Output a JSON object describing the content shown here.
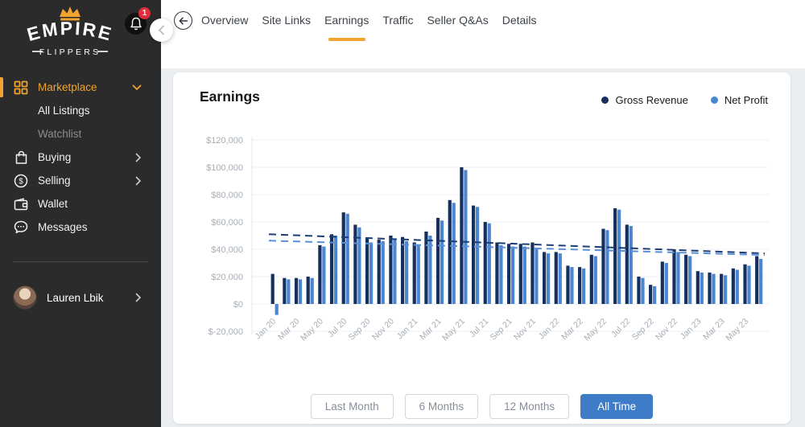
{
  "colors": {
    "accent_orange": "#f0a32f",
    "button_blue": "#3e7cc7",
    "sidebar_bg": "#2b2b2b",
    "gross_navy": "#16305e",
    "net_blue": "#4b86d2"
  },
  "sidebar": {
    "logo": {
      "title": "EMPIRE",
      "subtitle": "FLIPPERS"
    },
    "notification_count": "1",
    "items": [
      {
        "label": "Marketplace",
        "icon": "grid-icon",
        "active": true,
        "chevron": "down"
      },
      {
        "label": "All Listings"
      },
      {
        "label": "Watchlist",
        "muted": true
      },
      {
        "label": "Buying",
        "icon": "bag-icon",
        "chevron": "right"
      },
      {
        "label": "Selling",
        "icon": "dollar-icon",
        "chevron": "right"
      },
      {
        "label": "Wallet",
        "icon": "wallet-icon"
      },
      {
        "label": "Messages",
        "icon": "chat-icon"
      }
    ],
    "user": {
      "name": "Lauren Lbik"
    }
  },
  "topnav": {
    "tabs": [
      {
        "label": "Overview",
        "active": false
      },
      {
        "label": "Site Links",
        "active": false
      },
      {
        "label": "Earnings",
        "active": true
      },
      {
        "label": "Traffic",
        "active": false
      },
      {
        "label": "Seller Q&As",
        "active": false
      },
      {
        "label": "Details",
        "active": false
      }
    ]
  },
  "main": {
    "card_title": "Earnings",
    "legend": [
      {
        "label": "Gross Revenue",
        "color": "#16305e"
      },
      {
        "label": "Net Profit",
        "color": "#4b86d2"
      }
    ],
    "range_buttons": [
      {
        "label": "Last Month",
        "active": false
      },
      {
        "label": "6 Months",
        "active": false
      },
      {
        "label": "12 Months",
        "active": false
      },
      {
        "label": "All Time",
        "active": true
      }
    ]
  },
  "chart_data": {
    "type": "bar",
    "title": "Earnings",
    "categories": [
      "Jan 20",
      "Feb 20",
      "Mar 20",
      "Apr 20",
      "May 20",
      "Jun 20",
      "Jul 20",
      "Aug 20",
      "Sep 20",
      "Oct 20",
      "Nov 20",
      "Dec 20",
      "Jan 21",
      "Feb 21",
      "Mar 21",
      "Apr 21",
      "May 21",
      "Jun 21",
      "Jul 21",
      "Aug 21",
      "Sep 21",
      "Oct 21",
      "Nov 21",
      "Dec 21",
      "Jan 22",
      "Feb 22",
      "Mar 22",
      "Apr 22",
      "May 22",
      "Jun 22",
      "Jul 22",
      "Aug 22",
      "Sep 22",
      "Oct 22",
      "Nov 22",
      "Dec 22",
      "Jan 23",
      "Feb 23",
      "Mar 23",
      "Apr 23",
      "May 23",
      "Jun 23"
    ],
    "x_tick_labels": [
      "Jan 20",
      "Mar 20",
      "May 20",
      "Jul 20",
      "Sep 20",
      "Nov 20",
      "Jan 21",
      "Mar 21",
      "May 21",
      "Jul 21",
      "Sep 21",
      "Nov 21",
      "Jan 22",
      "Mar 22",
      "May 22",
      "Jul 22",
      "Sep 22",
      "Nov 22",
      "Jan 23",
      "Mar 23",
      "May 23"
    ],
    "series": [
      {
        "name": "Gross Revenue",
        "color": "#16305e",
        "values": [
          22000,
          19000,
          19000,
          20000,
          43000,
          51000,
          67000,
          58000,
          48000,
          47000,
          50000,
          49000,
          45000,
          53000,
          63000,
          76000,
          100000,
          72000,
          60000,
          45000,
          44000,
          44000,
          45000,
          38000,
          38000,
          28000,
          27000,
          36000,
          55000,
          70000,
          58000,
          20000,
          14000,
          31000,
          40000,
          36000,
          24000,
          23000,
          22000,
          26000,
          29000,
          35000
        ]
      },
      {
        "name": "Net Profit",
        "color": "#4b86d2",
        "values": [
          -8000,
          18000,
          18000,
          19000,
          42000,
          50000,
          66000,
          56000,
          45000,
          46000,
          47000,
          46000,
          43000,
          50000,
          61000,
          74000,
          98000,
          71000,
          59000,
          43000,
          42000,
          42000,
          40000,
          37000,
          37000,
          27000,
          26000,
          35000,
          54000,
          69000,
          57000,
          19000,
          13000,
          30000,
          38000,
          35000,
          23000,
          22000,
          21000,
          25000,
          28000,
          33000
        ]
      }
    ],
    "trend_lines": [
      {
        "series": "Gross Revenue",
        "style": "dashed",
        "color": "#1d3e75",
        "from": 51000,
        "to": 37000
      },
      {
        "series": "Net Profit",
        "style": "dashed",
        "color": "#5b8fd4",
        "from": 46300,
        "to": 35800
      }
    ],
    "y_ticks": [
      {
        "label": "$120,000",
        "value": 120000
      },
      {
        "label": "$100,000",
        "value": 100000
      },
      {
        "label": "$80,000",
        "value": 80000
      },
      {
        "label": "$60,000",
        "value": 60000
      },
      {
        "label": "$40,000",
        "value": 40000
      },
      {
        "label": "$20,000",
        "value": 20000
      },
      {
        "label": "$0",
        "value": 0
      },
      {
        "label": "$-20,000",
        "value": -20000
      }
    ],
    "ylim": [
      -20000,
      126000
    ],
    "grid": true,
    "legend_position": "top-right"
  }
}
